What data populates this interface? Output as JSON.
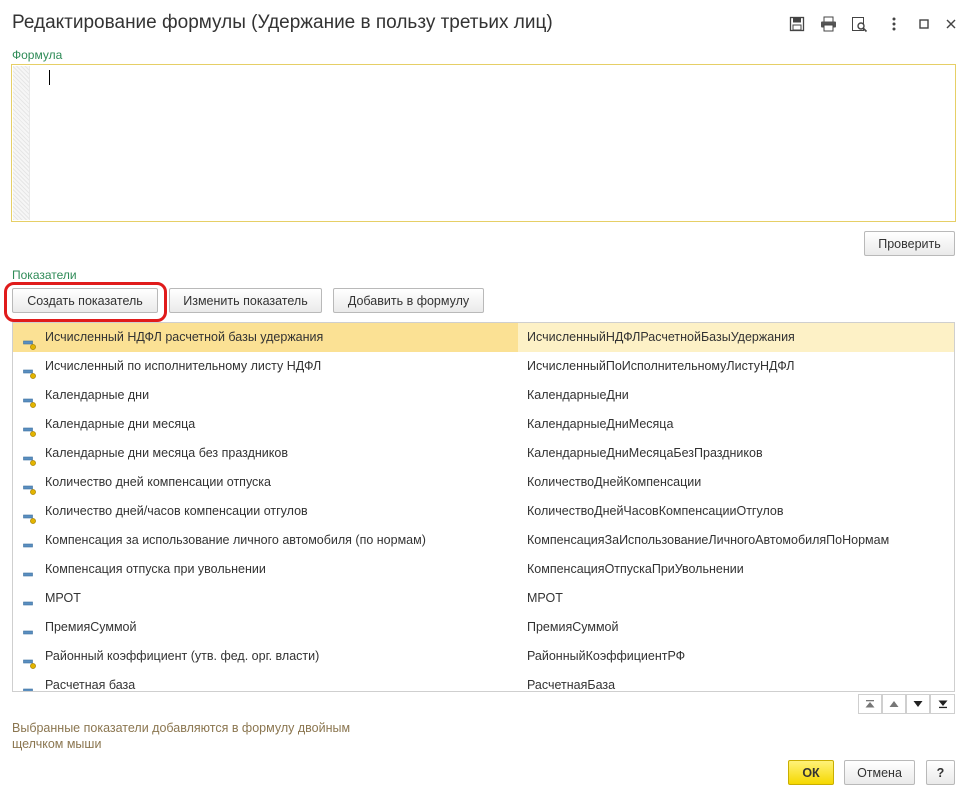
{
  "window": {
    "title": "Редактирование формулы (Удержание в пользу третьих лиц)",
    "icons": [
      "save-icon",
      "print-icon",
      "preview-icon",
      "more-icon",
      "maximize-icon",
      "close-icon"
    ]
  },
  "formula": {
    "label": "Формула",
    "value": "",
    "check_button": "Проверить"
  },
  "indicators": {
    "label": "Показатели",
    "create_button": "Создать показатель",
    "edit_button": "Изменить показатель",
    "add_button": "Добавить в формулу",
    "rows": [
      {
        "name": "Исчисленный НДФЛ расчетной базы удержания",
        "id": "ИсчисленныйНДФЛРасчетнойБазыУдержания",
        "icon": "indicator-icon",
        "selected": true
      },
      {
        "name": "Исчисленный по исполнительному листу НДФЛ",
        "id": "ИсчисленныйПоИсполнительномуЛистуНДФЛ",
        "icon": "indicator-icon",
        "selected": false
      },
      {
        "name": "Календарные дни",
        "id": "КалендарныеДни",
        "icon": "indicator-icon",
        "selected": false
      },
      {
        "name": "Календарные дни месяца",
        "id": "КалендарныеДниМесяца",
        "icon": "indicator-icon",
        "selected": false
      },
      {
        "name": "Календарные дни месяца без праздников",
        "id": "КалендарныеДниМесяцаБезПраздников",
        "icon": "indicator-icon",
        "selected": false
      },
      {
        "name": "Количество дней компенсации отпуска",
        "id": "КоличествоДнейКомпенсации",
        "icon": "indicator-icon",
        "selected": false
      },
      {
        "name": "Количество дней/часов компенсации отгулов",
        "id": "КоличествоДнейЧасовКомпенсацииОтгулов",
        "icon": "indicator-icon",
        "selected": false
      },
      {
        "name": "Компенсация за использование личного автомобиля (по нормам)",
        "id": "КомпенсацияЗаИспользованиеЛичногоАвтомобиляПоНормам",
        "icon": "constant-icon",
        "selected": false
      },
      {
        "name": "Компенсация отпуска при увольнении",
        "id": "КомпенсацияОтпускаПриУвольнении",
        "icon": "constant-icon",
        "selected": false
      },
      {
        "name": "МРОТ",
        "id": "МРОТ",
        "icon": "constant-icon",
        "selected": false
      },
      {
        "name": "ПремияСуммой",
        "id": "ПремияСуммой",
        "icon": "constant-icon",
        "selected": false
      },
      {
        "name": "Районный коэффициент (утв. фед. орг. власти)",
        "id": "РайонныйКоэффициентРФ",
        "icon": "indicator-icon",
        "selected": false
      },
      {
        "name": "Расчетная база",
        "id": "РасчетнаяБаза",
        "icon": "indicator-icon",
        "selected": false
      }
    ]
  },
  "list_nav": [
    "first-icon",
    "up-icon",
    "down-icon",
    "last-icon"
  ],
  "hint": "Выбранные показатели добавляются в формулу двойным щелчком мыши",
  "footer": {
    "ok_button": "ОК",
    "cancel_button": "Отмена",
    "help_button": "?"
  },
  "colors": {
    "accent_yellow": "#f5d800",
    "selected_row": "#fbe194",
    "section_label": "#2e8b57",
    "highlight_ring": "#e01b1b"
  }
}
